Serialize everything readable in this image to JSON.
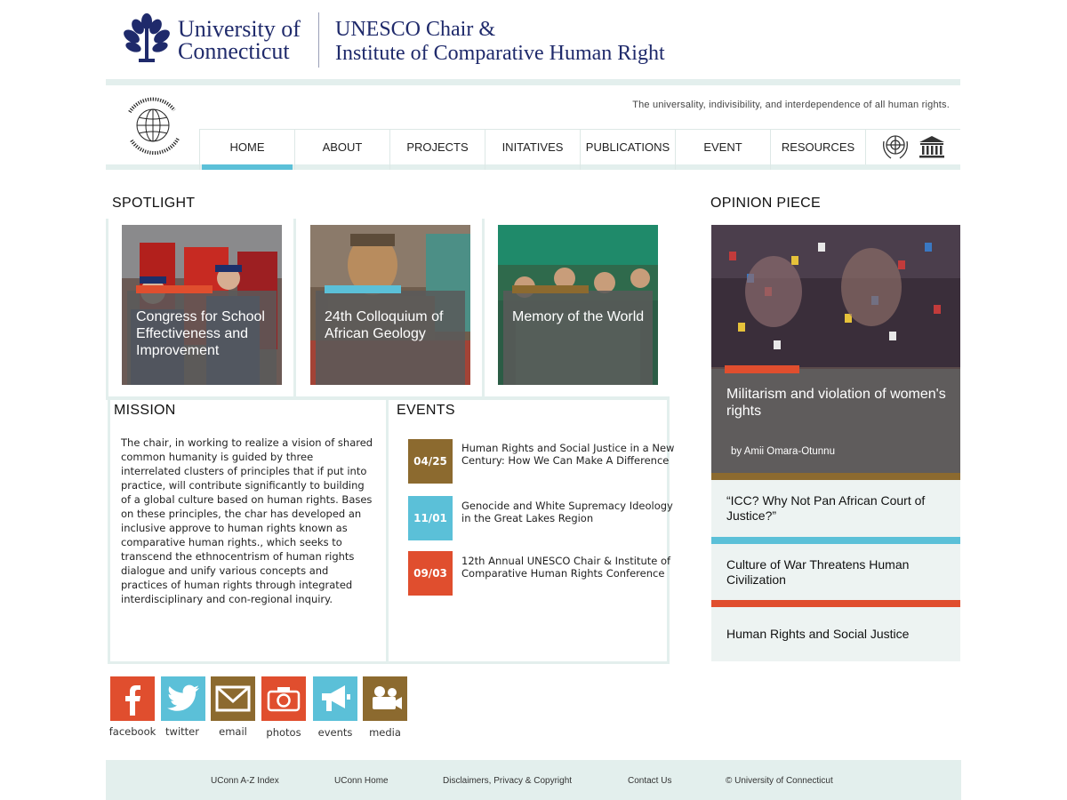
{
  "header": {
    "uconn_line1": "University of",
    "uconn_line2": "Connecticut",
    "unesco_line1": "UNESCO Chair &",
    "unesco_line2": "Institute of Comparative Human Right",
    "tagline": "The universality, indivisibility, and interdependence of all human rights."
  },
  "nav": {
    "items": [
      "HOME",
      "ABOUT",
      "PROJECTS",
      "INITATIVES",
      "PUBLICATIONS",
      "EVENT",
      "RESOURCES"
    ],
    "active": "HOME"
  },
  "spotlight": {
    "heading": "SPOTLIGHT",
    "cards": [
      {
        "title": "Congress for School Effectiveness and Improvement",
        "accent": "#e04e2e"
      },
      {
        "title": "24th Colloquium of African Geology",
        "accent": "#5bc0d8"
      },
      {
        "title": "Memory of the World",
        "accent": "#8c6a2f"
      }
    ]
  },
  "mission": {
    "heading": "MISSION",
    "text": "The chair, in working to realize a vision of shared common humanity is guided by three interrelated clusters of principles that if put into practice, will contribute significantly to building of a global culture based on human rights. Bases on these principles, the char has developed an inclusive approve to human rights known as comparative human rights., which seeks to transcend the ethnocentrism of human rights dialogue and unify various concepts and practices of human rights through integrated interdisciplinary and con-regional inquiry."
  },
  "events": {
    "heading": "EVENTS",
    "items": [
      {
        "date": "04/25",
        "title": "Human Rights and Social Justice in a New Century: How We Can Make A Difference",
        "color": "#8c6a2f"
      },
      {
        "date": "11/01",
        "title": "Genocide and White Supremacy Ideology in the Great Lakes Region",
        "color": "#5bc0d8"
      },
      {
        "date": "09/03",
        "title": "12th Annual UNESCO Chair & Institute of Comparative Human Rights Conference",
        "color": "#e04e2e"
      }
    ]
  },
  "social": [
    {
      "label": "facebook",
      "icon": "facebook-icon",
      "color": "#e04e2e"
    },
    {
      "label": "twitter",
      "icon": "twitter-icon",
      "color": "#5bc0d8"
    },
    {
      "label": "email",
      "icon": "email-icon",
      "color": "#8c6a2f"
    },
    {
      "label": "photos",
      "icon": "camera-icon",
      "color": "#e04e2e"
    },
    {
      "label": "events",
      "icon": "megaphone-icon",
      "color": "#5bc0d8"
    },
    {
      "label": "media",
      "icon": "video-camera-icon",
      "color": "#8c6a2f"
    }
  ],
  "opinion": {
    "heading": "OPINION PIECE",
    "featured_title": "Militarism and violation of women's rights",
    "featured_byline": "by Amii Omara-Otunnu",
    "items": [
      {
        "title": "“ICC? Why Not Pan African Court of Justice?”",
        "divider_color": "#5bc0d8"
      },
      {
        "title": "Culture of War Threatens Human Civilization",
        "divider_color": "#e04e2e"
      },
      {
        "title": "Human Rights and Social Justice"
      }
    ]
  },
  "footer": {
    "links": [
      "UConn A-Z Index",
      "UConn Home",
      "Disclaimers, Privacy & Copyright",
      "Contact Us",
      "© University of Connecticut"
    ]
  },
  "colors": {
    "accent_red": "#e04e2e",
    "accent_blue": "#5bc0d8",
    "accent_brown": "#8c6a2f",
    "navy": "#1f2a6b",
    "band": "#e3efed"
  }
}
